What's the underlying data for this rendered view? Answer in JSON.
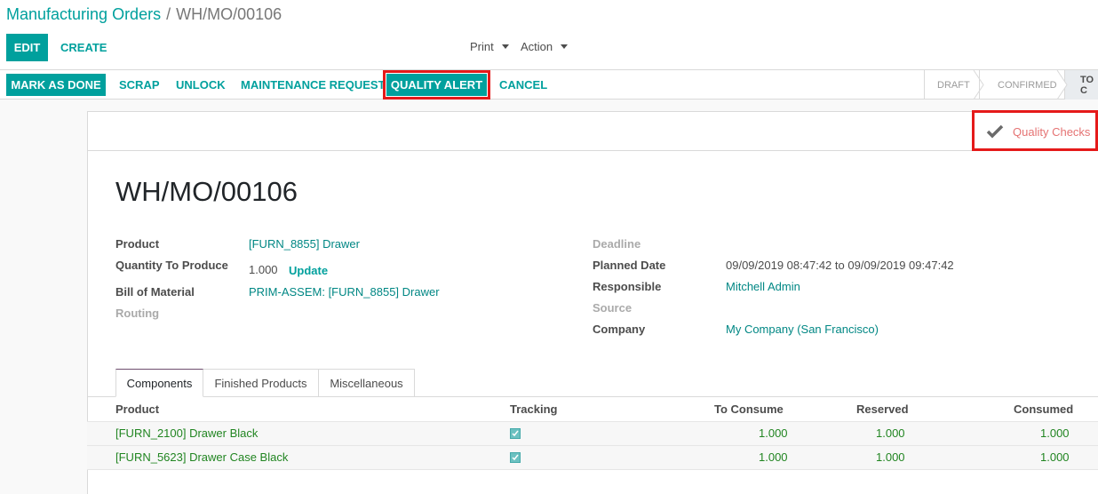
{
  "breadcrumb": {
    "parent": "Manufacturing Orders",
    "separator": "/",
    "current": "WH/MO/00106"
  },
  "toolbar": {
    "edit": "EDIT",
    "create": "CREATE",
    "print": "Print",
    "action": "Action"
  },
  "actions": {
    "mark_done": "MARK AS DONE",
    "scrap": "SCRAP",
    "unlock": "UNLOCK",
    "maintenance": "MAINTENANCE REQUEST",
    "quality_alert": "QUALITY ALERT",
    "cancel": "CANCEL"
  },
  "status": {
    "steps": [
      "DRAFT",
      "CONFIRMED",
      "TO C"
    ]
  },
  "smart_button": {
    "label": "Quality Checks",
    "icon": "check-icon"
  },
  "record": {
    "title": "WH/MO/00106",
    "left": {
      "product_label": "Product",
      "product_value": "[FURN_8855] Drawer",
      "qty_label": "Quantity To Produce",
      "qty_value": "1.000",
      "qty_update": "Update",
      "bom_label": "Bill of Material",
      "bom_value": "PRIM-ASSEM: [FURN_8855] Drawer",
      "routing_label": "Routing"
    },
    "right": {
      "deadline_label": "Deadline",
      "planned_label": "Planned Date",
      "planned_from": "09/09/2019 08:47:42",
      "planned_to_word": "to",
      "planned_to": "09/09/2019 09:47:42",
      "responsible_label": "Responsible",
      "responsible_value": "Mitchell Admin",
      "source_label": "Source",
      "company_label": "Company",
      "company_value": "My Company (San Francisco)"
    }
  },
  "tabs": [
    "Components",
    "Finished Products",
    "Miscellaneous"
  ],
  "table": {
    "headers": [
      "Product",
      "Tracking",
      "To Consume",
      "Reserved",
      "Consumed"
    ],
    "rows": [
      {
        "product": "[FURN_2100] Drawer Black",
        "to_consume": "1.000",
        "reserved": "1.000",
        "consumed": "1.000"
      },
      {
        "product": "[FURN_5623] Drawer Case Black",
        "to_consume": "1.000",
        "reserved": "1.000",
        "consumed": "1.000"
      }
    ]
  },
  "colors": {
    "accent": "#00A09D",
    "highlight": "#e51a1a",
    "quality_checks_text": "#e57373"
  }
}
